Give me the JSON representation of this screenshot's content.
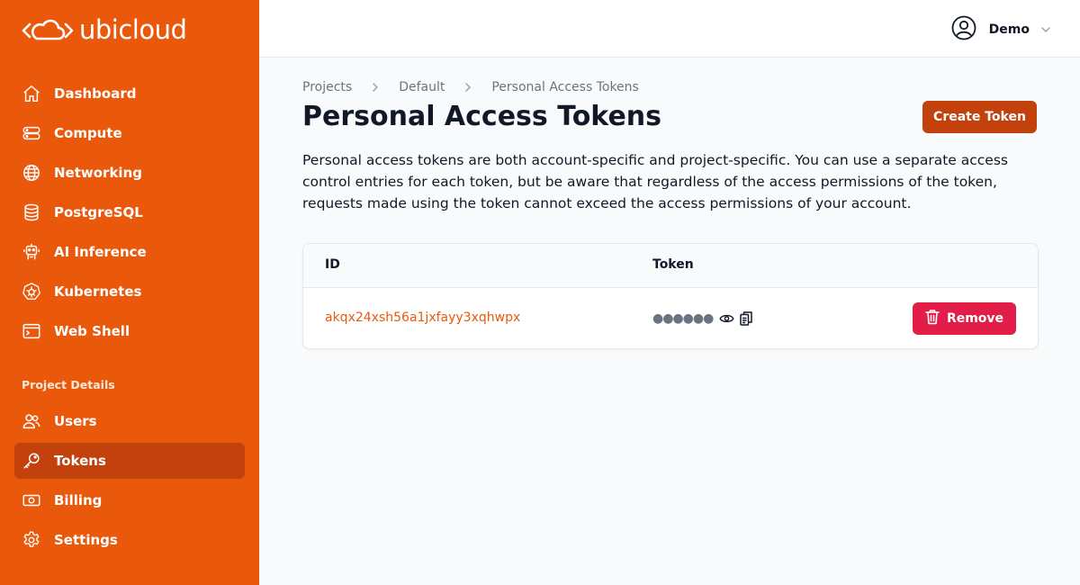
{
  "brand": {
    "name": "ubicloud"
  },
  "sidebar": {
    "items": [
      {
        "label": "Dashboard",
        "icon": "home-icon"
      },
      {
        "label": "Compute",
        "icon": "server-icon"
      },
      {
        "label": "Networking",
        "icon": "globe-icon"
      },
      {
        "label": "PostgreSQL",
        "icon": "database-icon"
      },
      {
        "label": "AI Inference",
        "icon": "robot-icon"
      },
      {
        "label": "Kubernetes",
        "icon": "kubernetes-icon"
      },
      {
        "label": "Web Shell",
        "icon": "terminal-icon"
      }
    ],
    "section_label": "Project Details",
    "project_items": [
      {
        "label": "Users",
        "icon": "users-icon"
      },
      {
        "label": "Tokens",
        "icon": "key-icon",
        "active": true
      },
      {
        "label": "Billing",
        "icon": "banknote-icon"
      },
      {
        "label": "Settings",
        "icon": "gear-icon"
      }
    ]
  },
  "header": {
    "user_name": "Demo"
  },
  "breadcrumb": [
    "Projects",
    "Default",
    "Personal Access Tokens"
  ],
  "page": {
    "title": "Personal Access Tokens",
    "create_button": "Create Token",
    "description": "Personal access tokens are both account-specific and project-specific. You can use a separate access control entries for each token, but be aware that regardless of the access permissions of the token, requests made using the token cannot exceed the access permissions of your account."
  },
  "table": {
    "columns": [
      "ID",
      "Token"
    ],
    "rows": [
      {
        "id": "akqx24xsh56a1jxfayy3xqhwpx",
        "token_masked": "●●●●●●",
        "remove_label": "Remove"
      }
    ]
  },
  "colors": {
    "sidebar": "#ea580c",
    "primary_button": "#c2410c",
    "danger": "#e11d48",
    "link": "#ea580c"
  }
}
